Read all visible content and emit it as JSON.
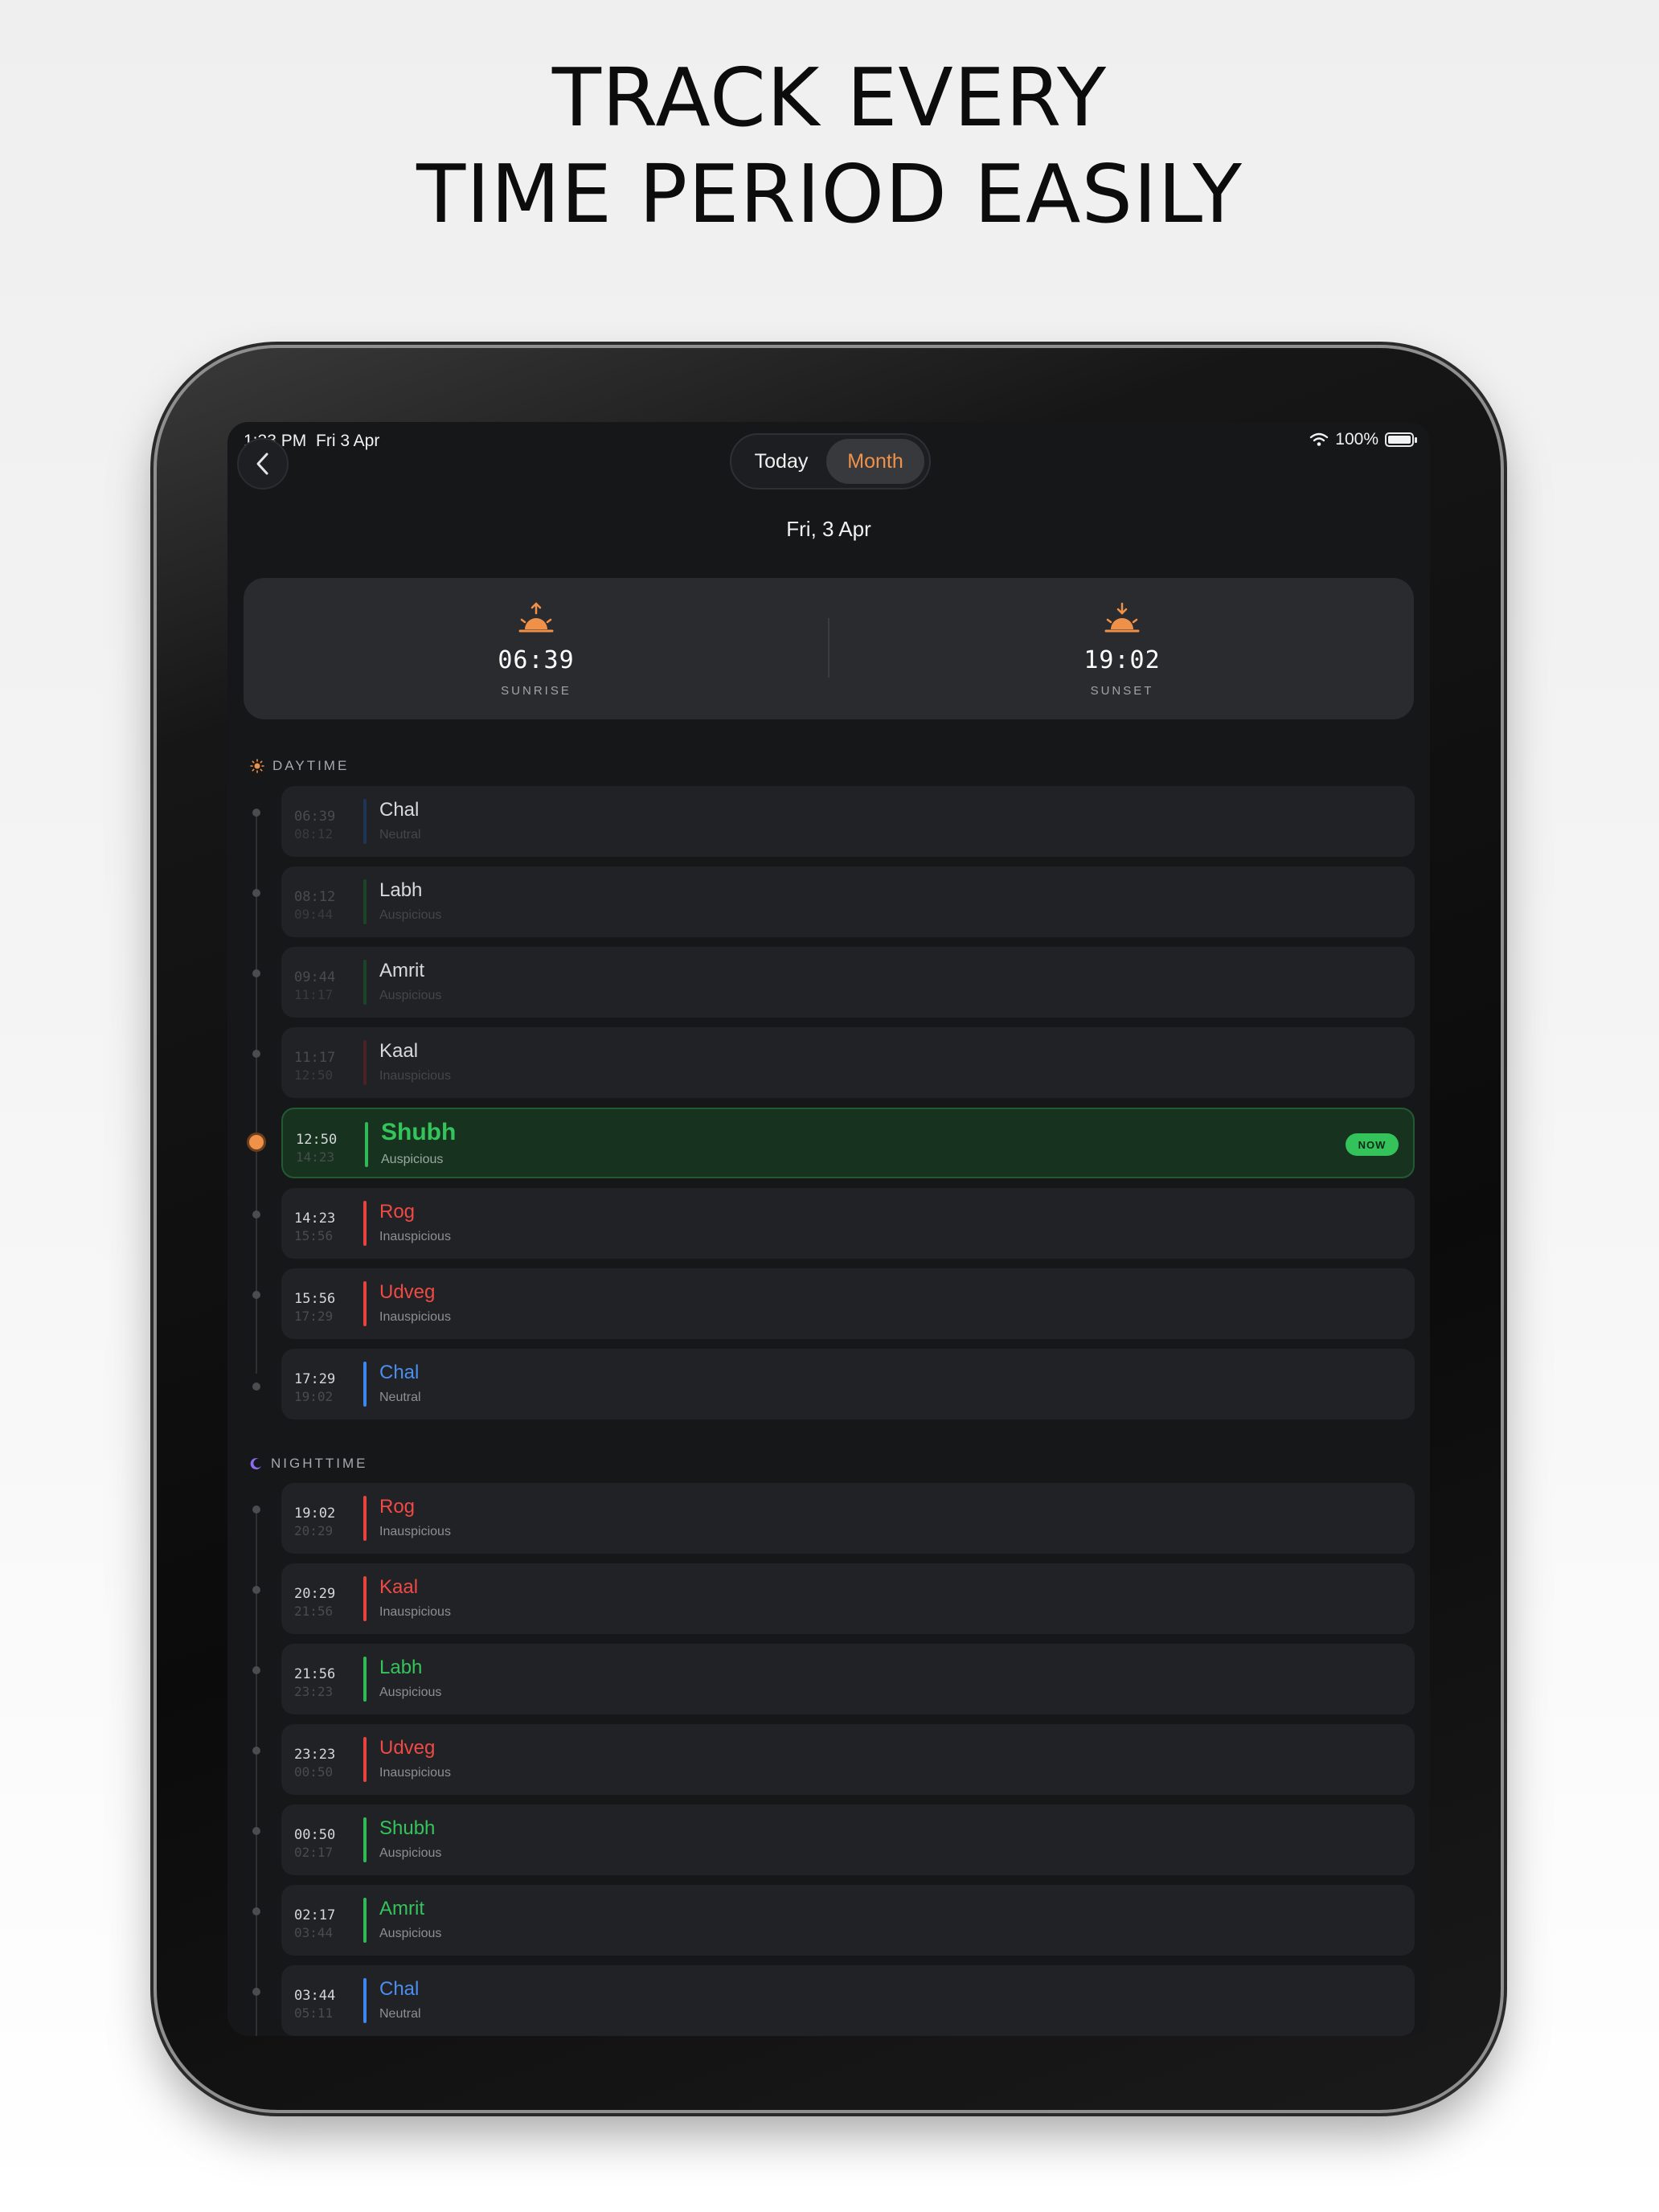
{
  "headline": {
    "line1": "TRACK EVERY",
    "line2": "TIME PERIOD EASILY"
  },
  "status_bar": {
    "time": "1:33 PM",
    "date": "Fri 3 Apr",
    "battery": "100%"
  },
  "segment": {
    "today": "Today",
    "month": "Month",
    "selected": "Month"
  },
  "date_title": "Fri, 3 Apr",
  "sun": {
    "sunrise_time": "06:39",
    "sunrise_label": "SUNRISE",
    "sunset_time": "19:02",
    "sunset_label": "SUNSET"
  },
  "daytime": {
    "header": "DAYTIME",
    "rows": [
      {
        "start": "06:39",
        "end": "08:12",
        "name": "Chal",
        "quality": "Neutral"
      },
      {
        "start": "08:12",
        "end": "09:44",
        "name": "Labh",
        "quality": "Auspicious"
      },
      {
        "start": "09:44",
        "end": "11:17",
        "name": "Amrit",
        "quality": "Auspicious"
      },
      {
        "start": "11:17",
        "end": "12:50",
        "name": "Kaal",
        "quality": "Inauspicious"
      },
      {
        "start": "12:50",
        "end": "14:23",
        "name": "Shubh",
        "quality": "Auspicious",
        "badge": "NOW"
      },
      {
        "start": "14:23",
        "end": "15:56",
        "name": "Rog",
        "quality": "Inauspicious"
      },
      {
        "start": "15:56",
        "end": "17:29",
        "name": "Udveg",
        "quality": "Inauspicious"
      },
      {
        "start": "17:29",
        "end": "19:02",
        "name": "Chal",
        "quality": "Neutral"
      }
    ]
  },
  "nighttime": {
    "header": "NIGHTTIME",
    "rows": [
      {
        "start": "19:02",
        "end": "20:29",
        "name": "Rog",
        "quality": "Inauspicious"
      },
      {
        "start": "20:29",
        "end": "21:56",
        "name": "Kaal",
        "quality": "Inauspicious"
      },
      {
        "start": "21:56",
        "end": "23:23",
        "name": "Labh",
        "quality": "Auspicious"
      },
      {
        "start": "23:23",
        "end": "00:50",
        "name": "Udveg",
        "quality": "Inauspicious"
      },
      {
        "start": "00:50",
        "end": "02:17",
        "name": "Shubh",
        "quality": "Auspicious"
      },
      {
        "start": "02:17",
        "end": "03:44",
        "name": "Amrit",
        "quality": "Auspicious"
      },
      {
        "start": "03:44",
        "end": "05:11",
        "name": "Chal",
        "quality": "Neutral"
      }
    ]
  },
  "colors": {
    "accent_orange": "#f0914a",
    "neutral_blue": "#3f86f0",
    "auspicious_green": "#31b957",
    "inauspicious_red": "#e8433f"
  }
}
